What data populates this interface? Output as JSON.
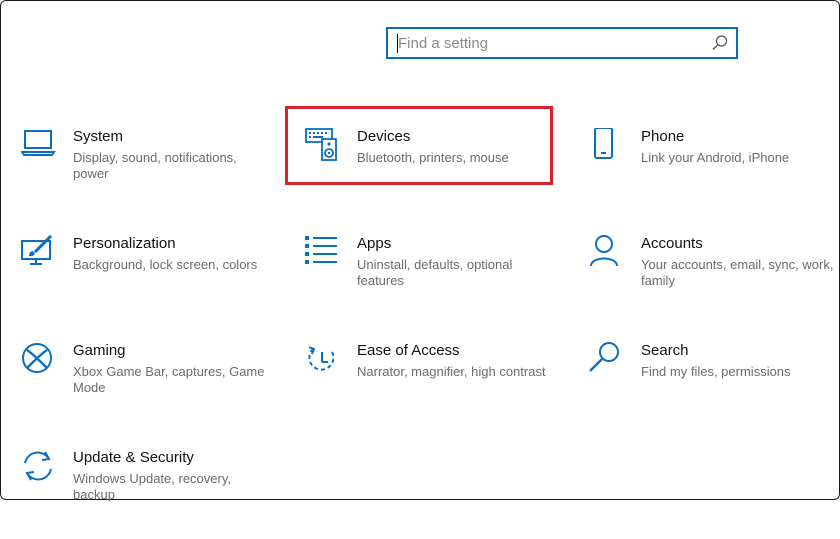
{
  "search": {
    "placeholder": "Find a setting",
    "value": "",
    "icon": "search-icon"
  },
  "tiles": [
    {
      "title": "System",
      "desc": "Display, sound, notifications, power",
      "icon": "laptop-icon"
    },
    {
      "title": "Devices",
      "desc": "Bluetooth, printers, mouse",
      "icon": "keyboard-speaker-icon",
      "highlighted": true
    },
    {
      "title": "Phone",
      "desc": "Link your Android, iPhone",
      "icon": "phone-icon"
    },
    {
      "title": "Personalization",
      "desc": "Background, lock screen, colors",
      "icon": "paintbrush-monitor-icon"
    },
    {
      "title": "Apps",
      "desc": "Uninstall, defaults, optional features",
      "icon": "app-list-icon"
    },
    {
      "title": "Accounts",
      "desc": "Your accounts, email, sync, work, family",
      "icon": "person-icon"
    },
    {
      "title": "Gaming",
      "desc": "Xbox Game Bar, captures, Game Mode",
      "icon": "xbox-icon"
    },
    {
      "title": "Ease of Access",
      "desc": "Narrator, magnifier, high contrast",
      "icon": "ease-of-access-icon"
    },
    {
      "title": "Search",
      "desc": "Find my files, permissions",
      "icon": "magnifier-icon"
    },
    {
      "title": "Update & Security",
      "desc": "Windows Update, recovery, backup",
      "icon": "sync-arrows-icon"
    }
  ],
  "colors": {
    "accent": "#0a6fc2",
    "highlight": "#d6242c",
    "title": "#111111",
    "desc": "#6b6b6b"
  }
}
